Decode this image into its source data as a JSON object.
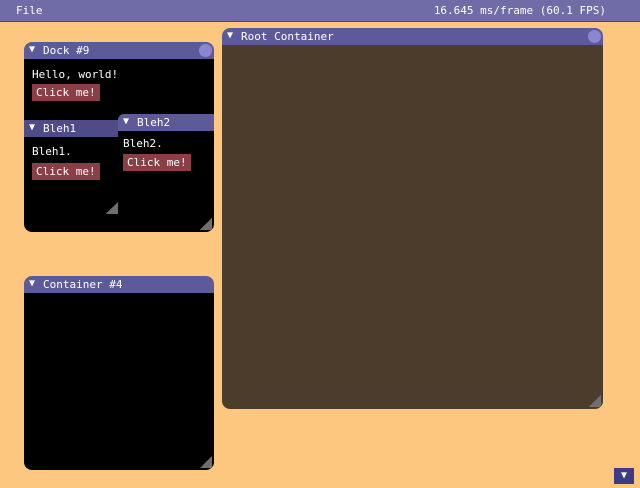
{
  "menubar": {
    "file_label": "File",
    "fps_text": "16.645 ms/frame (60.1 FPS)"
  },
  "arrow_glyph": "▼",
  "windows": {
    "dock9": {
      "title": "Dock #9",
      "hello_text": "Hello, world!",
      "button_label": "Click me!"
    },
    "bleh1": {
      "title": "Bleh1",
      "body_text": "Bleh1.",
      "button_label": "Click me!"
    },
    "bleh2": {
      "title": "Bleh2",
      "body_text": "Bleh2.",
      "button_label": "Click me!"
    },
    "container4": {
      "title": "Container #4"
    },
    "root": {
      "title": "Root Container"
    }
  },
  "colors": {
    "background": "#fec780",
    "titlebar": "#5d5a9b",
    "button": "#8a3e45",
    "root_body": "#4b3c2b"
  },
  "icons": {
    "collapse": "triangle-down-icon",
    "close": "close-dot-icon",
    "resize": "resize-grip-icon"
  }
}
